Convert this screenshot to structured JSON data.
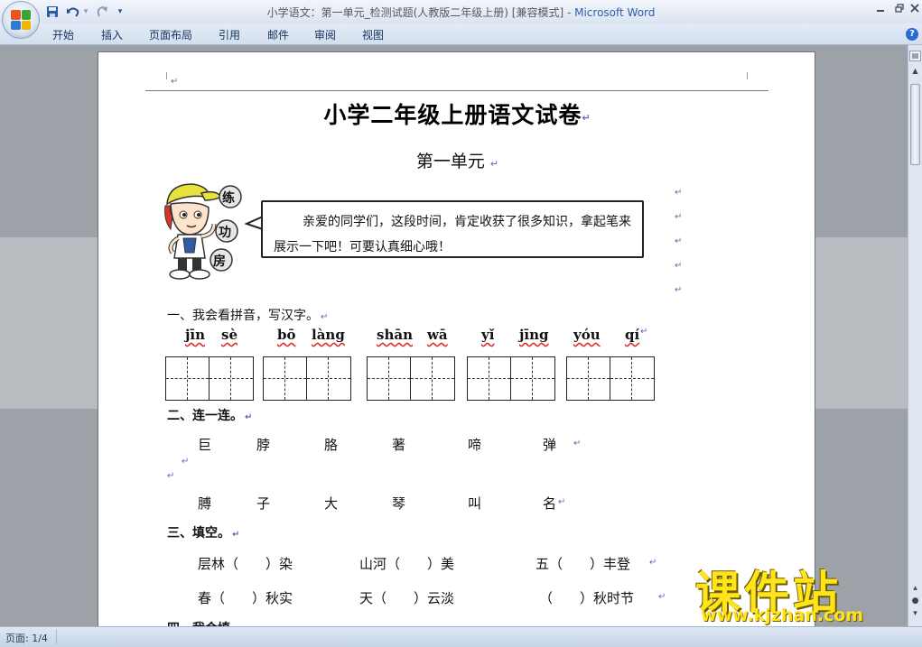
{
  "window": {
    "title": "小学语文：第一单元_检测试题(人教版二年级上册) [兼容模式] - ",
    "app_name": "Microsoft Word"
  },
  "quick_access": {
    "save_icon": "floppy-disk-icon",
    "undo_icon": "undo-arrow",
    "redo_icon": "redo-arrow",
    "customize_glyph": "▾"
  },
  "ribbon_tabs": [
    "开始",
    "插入",
    "页面布局",
    "引用",
    "邮件",
    "审阅",
    "视图"
  ],
  "status": {
    "page": "页面: 1/4"
  },
  "document": {
    "title": "小学二年级上册语文试卷",
    "subtitle": "第一单元",
    "mascot_labels": [
      "练",
      "功",
      "房"
    ],
    "bubble_text": "亲爱的同学们，这段时间，肯定收获了很多知识，拿起笔来展示一下吧！可要认真细心哦！",
    "section1": {
      "title": "一、我会看拼音，写汉字。",
      "pinyin": [
        "jīn",
        "sè",
        "bō",
        "làng",
        "shān",
        "wā",
        "yǐ",
        "jīng",
        "yóu",
        "qí"
      ]
    },
    "section2": {
      "title": "二、连一连。",
      "row1": [
        "巨",
        "脖",
        "胳",
        "著",
        "啼",
        "弹"
      ],
      "row2": [
        "膊",
        "子",
        "大",
        "琴",
        "叫",
        "名"
      ]
    },
    "section3": {
      "title": "三、填空。",
      "row1": [
        "层林（　　）染",
        "山河（　　）美",
        "五（　　）丰登"
      ],
      "row2": [
        "春（　　）秋实",
        "天（　　）云淡",
        "（　　）秋时节"
      ]
    },
    "section4_partial": "四、我会填"
  },
  "watermark": {
    "big": "课件站",
    "small": "www.kjzhan.com"
  },
  "colors": {
    "app_name": "#2e5fa8",
    "watermark": "#ffe41a",
    "paragraph_mark": "#5a6bb0"
  }
}
